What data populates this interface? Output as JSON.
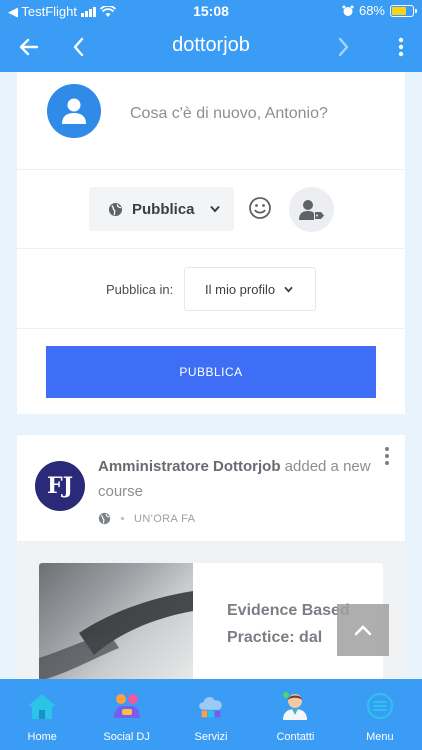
{
  "status_bar": {
    "carrier": "◀ TestFlight",
    "time": "15:08",
    "battery": "68%",
    "battery_level": 0.68
  },
  "nav": {
    "title": "dottorjob"
  },
  "composer": {
    "placeholder": "Cosa c'è di nuovo, Antonio?",
    "visibility": "Pubblica",
    "publish_in_label": "Pubblica in:",
    "publish_in_value": "Il mio profilo",
    "publish_button": "PUBBLICA"
  },
  "post": {
    "author": "Amministratore Dottorjob",
    "action": " added a new course",
    "logo_text": "FJ",
    "time": "UN'ORA FA",
    "course_title": "Evidence Based Practice: dal"
  },
  "tabs": [
    {
      "label": "Home",
      "icon": "home-icon"
    },
    {
      "label": "Social DJ",
      "icon": "social-icon"
    },
    {
      "label": "Servizi",
      "icon": "cloud-icon"
    },
    {
      "label": "Contatti",
      "icon": "doctor-icon"
    },
    {
      "label": "Menu",
      "icon": "menu-icon"
    }
  ],
  "colors": {
    "primary": "#3b9cf5",
    "button": "#3e6ef5",
    "avatar": "#2f8ae8"
  }
}
